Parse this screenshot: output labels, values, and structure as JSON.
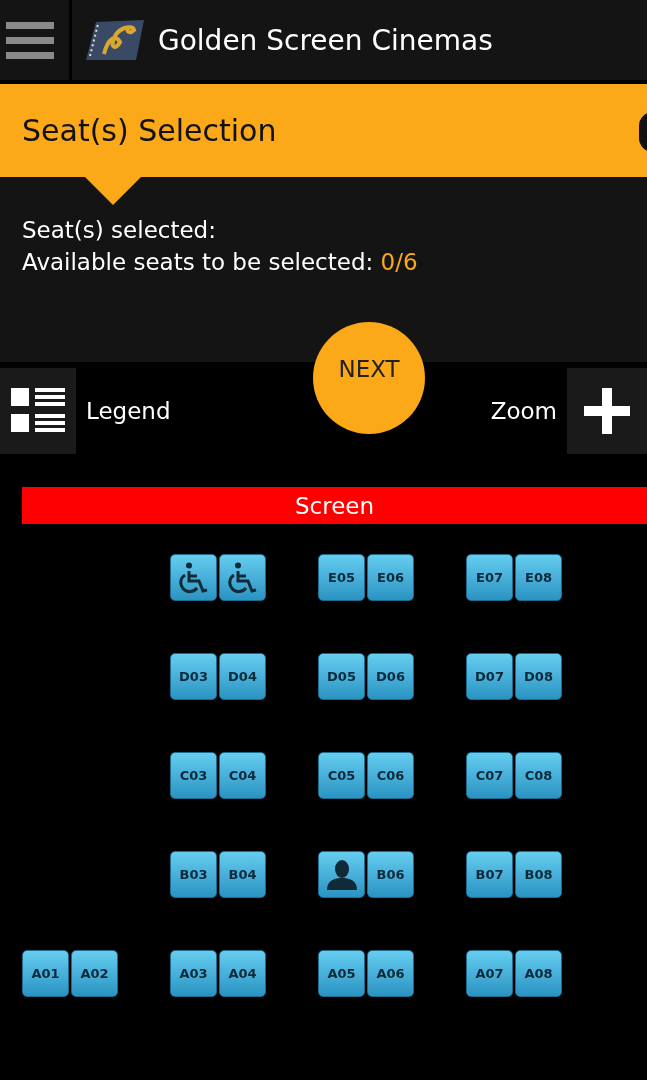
{
  "app_bar": {
    "title": "Golden Screen Cinemas"
  },
  "banner": {
    "title": "Seat(s) Selection"
  },
  "summary": {
    "selected_label": "Seat(s) selected:",
    "available_label": "Available seats to be selected:",
    "available_count": "0/6"
  },
  "next_button": {
    "label": "NEXT"
  },
  "legend_button": {
    "label": "Legend"
  },
  "zoom_button": {
    "label": "Zoom"
  },
  "screen": {
    "label": "Screen"
  },
  "seat_rows": [
    {
      "blocks": [
        {
          "kind": "gap"
        },
        {
          "kind": "pair",
          "seats": [
            {
              "kind": "wheelchair"
            },
            {
              "kind": "wheelchair"
            }
          ]
        },
        {
          "kind": "pair",
          "seats": [
            {
              "kind": "standard",
              "label": "E05"
            },
            {
              "kind": "standard",
              "label": "E06"
            }
          ]
        },
        {
          "kind": "pair",
          "seats": [
            {
              "kind": "standard",
              "label": "E07"
            },
            {
              "kind": "standard",
              "label": "E08"
            }
          ]
        }
      ]
    },
    {
      "blocks": [
        {
          "kind": "gap"
        },
        {
          "kind": "pair",
          "seats": [
            {
              "kind": "standard",
              "label": "D03"
            },
            {
              "kind": "standard",
              "label": "D04"
            }
          ]
        },
        {
          "kind": "pair",
          "seats": [
            {
              "kind": "standard",
              "label": "D05"
            },
            {
              "kind": "standard",
              "label": "D06"
            }
          ]
        },
        {
          "kind": "pair",
          "seats": [
            {
              "kind": "standard",
              "label": "D07"
            },
            {
              "kind": "standard",
              "label": "D08"
            }
          ]
        }
      ]
    },
    {
      "blocks": [
        {
          "kind": "gap"
        },
        {
          "kind": "pair",
          "seats": [
            {
              "kind": "standard",
              "label": "C03"
            },
            {
              "kind": "standard",
              "label": "C04"
            }
          ]
        },
        {
          "kind": "pair",
          "seats": [
            {
              "kind": "standard",
              "label": "C05"
            },
            {
              "kind": "standard",
              "label": "C06"
            }
          ]
        },
        {
          "kind": "pair",
          "seats": [
            {
              "kind": "standard",
              "label": "C07"
            },
            {
              "kind": "standard",
              "label": "C08"
            }
          ]
        }
      ]
    },
    {
      "blocks": [
        {
          "kind": "gap"
        },
        {
          "kind": "pair",
          "seats": [
            {
              "kind": "standard",
              "label": "B03"
            },
            {
              "kind": "standard",
              "label": "B04"
            }
          ]
        },
        {
          "kind": "pair",
          "seats": [
            {
              "kind": "occupied"
            },
            {
              "kind": "standard",
              "label": "B06"
            }
          ]
        },
        {
          "kind": "pair",
          "seats": [
            {
              "kind": "standard",
              "label": "B07"
            },
            {
              "kind": "standard",
              "label": "B08"
            }
          ]
        }
      ]
    },
    {
      "blocks": [
        {
          "kind": "pair",
          "seats": [
            {
              "kind": "standard",
              "label": "A01"
            },
            {
              "kind": "standard",
              "label": "A02"
            }
          ]
        },
        {
          "kind": "pair",
          "seats": [
            {
              "kind": "standard",
              "label": "A03"
            },
            {
              "kind": "standard",
              "label": "A04"
            }
          ]
        },
        {
          "kind": "pair",
          "seats": [
            {
              "kind": "standard",
              "label": "A05"
            },
            {
              "kind": "standard",
              "label": "A06"
            }
          ]
        },
        {
          "kind": "pair",
          "seats": [
            {
              "kind": "standard",
              "label": "A07"
            },
            {
              "kind": "standard",
              "label": "A08"
            }
          ]
        }
      ]
    }
  ]
}
